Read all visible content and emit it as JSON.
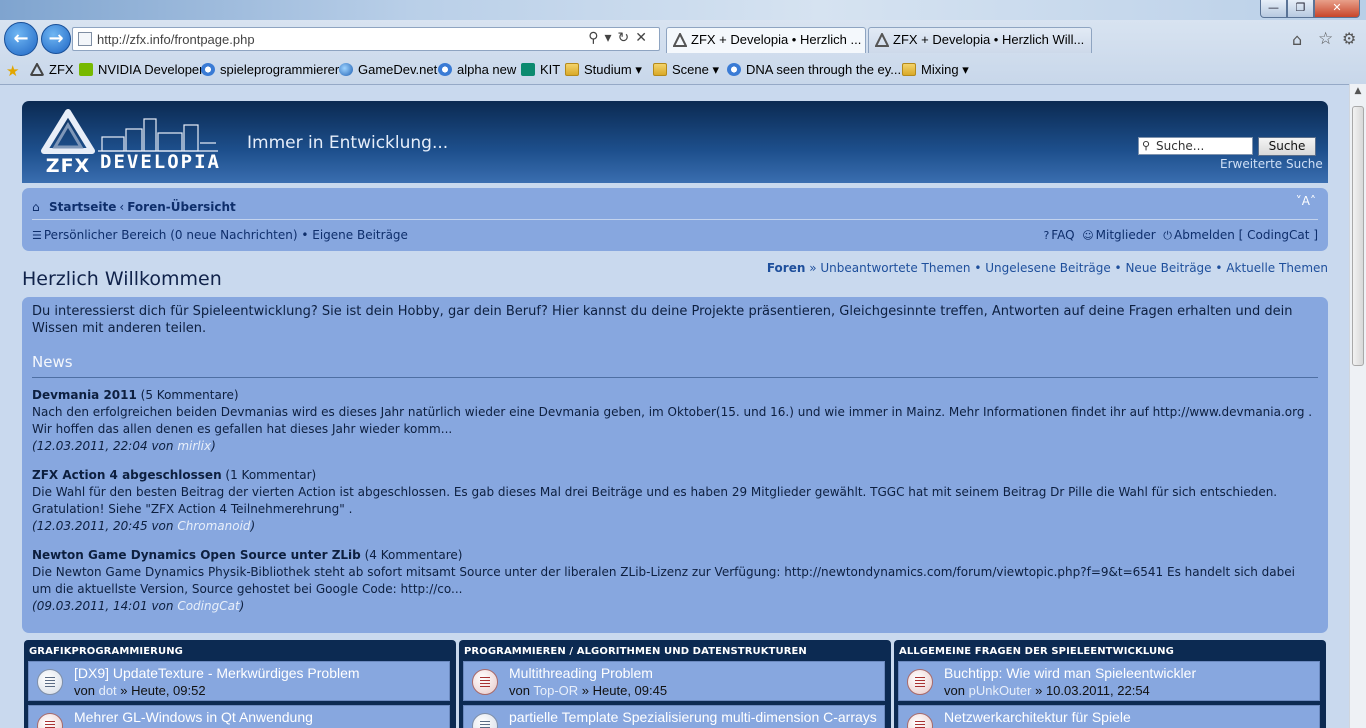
{
  "browser": {
    "window_controls": {
      "minimize": "—",
      "maximize": "❐",
      "close": "✕"
    },
    "address_url": "http://zfx.info/frontpage.php",
    "tabs": [
      {
        "label": "ZFX + Developia • Herzlich ..."
      },
      {
        "label": "ZFX + Developia • Herzlich Will..."
      }
    ],
    "favorites": [
      {
        "label": "ZFX",
        "icon": "zfx-icon"
      },
      {
        "label": "NVIDIA Developer",
        "icon": "nvidia-icon"
      },
      {
        "label": "spieleprogrammierer",
        "icon": "ie-page-icon"
      },
      {
        "label": "GameDev.net",
        "icon": "globe-icon"
      },
      {
        "label": "alpha new",
        "icon": "ie-page-icon"
      },
      {
        "label": "KIT",
        "icon": "kit-icon"
      },
      {
        "label": "Studium",
        "icon": "folder-icon"
      },
      {
        "label": "Scene",
        "icon": "folder-icon"
      },
      {
        "label": "DNA seen through the ey...",
        "icon": "ie-page-icon"
      },
      {
        "label": "Mixing",
        "icon": "folder-icon"
      }
    ]
  },
  "header": {
    "logo_text": "ZFX",
    "logo_subtext": "DEVELOPIA",
    "tagline": "Immer in Entwicklung...",
    "search_placeholder": "Suche...",
    "search_button": "Suche",
    "advanced_search": "Erweiterte Suche"
  },
  "navbar": {
    "breadcrumb": [
      "Startseite",
      "Foren-Übersicht"
    ],
    "font_size_toggle": "˅A˄",
    "ucp_label": "Persönlicher Bereich",
    "messages_count": "0",
    "messages_label": "neue Nachrichten",
    "own_posts": "Eigene Beiträge",
    "faq": "FAQ",
    "members": "Mitglieder",
    "logout": "Abmelden",
    "username": "CodingCat"
  },
  "main": {
    "title": "Herzlich Willkommen",
    "quick_links": {
      "forums": "Foren",
      "unanswered": "Unbeantwortete Themen",
      "unread": "Ungelesene Beiträge",
      "new_posts": "Neue Beiträge",
      "active": "Aktuelle Themen"
    },
    "intro": "Du interessierst dich für Spieleentwicklung? Sie ist dein Hobby, gar dein Beruf? Hier kannst du deine Projekte präsentieren, Gleichgesinnte treffen, Antworten auf deine Fragen erhalten und dein Wissen mit anderen teilen.",
    "news_heading": "News",
    "news": [
      {
        "title": "Devmania 2011",
        "comments": "5 Kommentare",
        "body": "Nach den erfolgreichen beiden Devmanias wird es dieses Jahr natürlich wieder eine Devmania geben, im Oktober(15. und 16.) und wie immer in Mainz. Mehr Informationen findet ihr auf http://www.devmania.org . Wir hoffen das allen denen es gefallen hat dieses Jahr wieder komm...",
        "date": "12.03.2011, 22:04",
        "author": "mirlix"
      },
      {
        "title": "ZFX Action 4 abgeschlossen",
        "comments": "1 Kommentar",
        "body": "Die Wahl für den besten Beitrag der vierten Action ist abgeschlossen. Es gab dieses Mal drei Beiträge und es haben 29 Mitglieder gewählt. TGGC hat mit seinem Beitrag Dr Pille die Wahl für sich entschieden. Gratulation! Siehe \"ZFX Action 4 Teilnehmerehrung\" .",
        "date": "12.03.2011, 20:45",
        "author": "Chromanoid"
      },
      {
        "title": "Newton Game Dynamics Open Source unter ZLib",
        "comments": "4 Kommentare",
        "body": "Die Newton Game Dynamics Physik-Bibliothek steht ab sofort mitsamt Source unter der liberalen ZLib-Lizenz zur Verfügung: http://newtondynamics.com/forum/viewtopic.php?f=9&t=6541 Es handelt sich dabei um die aktuellste Version, Source gehostet bei Google Code: http://co...",
        "date": "09.03.2011, 14:01",
        "author": "CodingCat"
      }
    ],
    "von": "von"
  },
  "forums": [
    {
      "title": "GRAFIKPROGRAMMIERUNG",
      "topics": [
        {
          "title": "[DX9] UpdateTexture - Merkwürdiges Problem",
          "author": "dot",
          "time": "Heute, 09:52",
          "hot": false
        },
        {
          "title": "Mehrer GL-Windows in Qt Anwendung",
          "author": "",
          "time": "",
          "hot": true
        }
      ]
    },
    {
      "title": "PROGRAMMIEREN / ALGORITHMEN UND DATENSTRUKTUREN",
      "topics": [
        {
          "title": "Multithreading Problem",
          "author": "Top-OR",
          "time": "Heute, 09:45",
          "hot": true
        },
        {
          "title": "partielle Template Spezialisierung multi-dimension C-arrays",
          "author": "",
          "time": "",
          "hot": false
        }
      ]
    },
    {
      "title": "ALLGEMEINE FRAGEN DER SPIELEENTWICKLUNG",
      "topics": [
        {
          "title": "Buchtipp: Wie wird man Spieleentwickler",
          "author": "pUnkOuter",
          "time": "10.03.2011, 22:54",
          "hot": true
        },
        {
          "title": "Netzwerkarchitektur für Spiele",
          "author": "",
          "time": "",
          "hot": true
        }
      ]
    }
  ]
}
